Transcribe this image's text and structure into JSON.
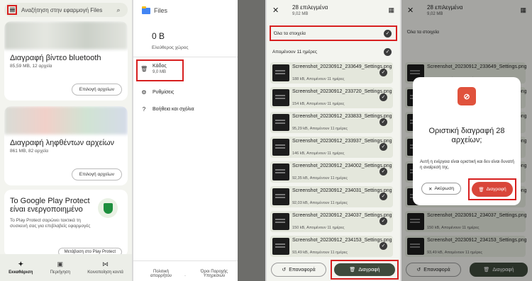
{
  "panel1": {
    "search_placeholder": "Αναζήτηση στην εφαρμογή Files",
    "card1": {
      "title": "Διαγραφή βίντεο bluetooth",
      "sub": "85,59 MB, 12 αρχεία",
      "button": "Επιλογή αρχείων"
    },
    "card2": {
      "title": "Διαγραφή ληφθέντων αρχείων",
      "sub": "861 MB, 82 αρχεία",
      "button": "Επιλογή αρχείων"
    },
    "card3": {
      "title": "To Google Play Protect είναι ενεργοποιημένο",
      "sub": "To Play Protect σαρώνει τακτικά τη συσκευή σας για επιβλαβείς εφαρμογές",
      "link": "Μετάβαση στο Play Protect"
    },
    "nav": [
      {
        "label": "Εκκαθάριση",
        "icon": "sparkle-icon"
      },
      {
        "label": "Περιήγηση",
        "icon": "browse-icon"
      },
      {
        "label": "Κοινοποίηση κοντά",
        "icon": "nearby-share-icon"
      }
    ]
  },
  "panel2": {
    "app_name": "Files",
    "storage_value": "0 B",
    "storage_label": "Ελεύθερος χώρος",
    "items": [
      {
        "label": "Κάδος",
        "sub": "9,0 MB",
        "icon": "trash-icon"
      },
      {
        "label": "Ρυθμίσεις",
        "sub": "",
        "icon": "settings-icon"
      },
      {
        "label": "Βοήθεια και σχόλια",
        "sub": "",
        "icon": "help-icon"
      }
    ],
    "footer_left": "Πολιτική απορρήτου",
    "footer_right": "Όροι Παροχής Υπηρεσιών"
  },
  "panel3": {
    "title": "28 επιλεγμένα",
    "size": "9,02 MB",
    "select_all": "Όλα τα στοιχεία",
    "group_label": "Απομένουν 11 ημέρες",
    "files": [
      {
        "name": "Screenshot_20230912_233649_Settings.png",
        "meta": "188 kB, Απομένουν 11 ημέρες"
      },
      {
        "name": "Screenshot_20230912_233720_Settings.png",
        "meta": "154 kB, Απομένουν 11 ημέρες"
      },
      {
        "name": "Screenshot_20230912_233833_Settings.png",
        "meta": "95,29 kB, Απομένουν 11 ημέρες"
      },
      {
        "name": "Screenshot_20230912_233937_Settings.png",
        "meta": "146 kB, Απομένουν 11 ημέρες"
      },
      {
        "name": "Screenshot_20230912_234002_Settings.png",
        "meta": "92,35 kB, Απομένουν 11 ημέρες"
      },
      {
        "name": "Screenshot_20230912_234031_Settings.png",
        "meta": "92,03 kB, Απομένουν 11 ημέρες"
      },
      {
        "name": "Screenshot_20230912_234037_Settings.png",
        "meta": "150 kB, Απομένουν 11 ημέρες"
      },
      {
        "name": "Screenshot_20230912_234153_Settings.png",
        "meta": "93,49 kB, Απομένουν 11 ημέρες"
      }
    ],
    "restore_label": "Επαναφορά",
    "delete_label": "Διαγραφή"
  },
  "panel4": {
    "title": "28 επιλεγμένα",
    "size": "9,02 MB",
    "select_all": "Όλα τα στοιχεία",
    "dialog_title": "Οριστική διαγραφή 28 αρχείων;",
    "dialog_body": "Αυτή η ενέργεια είναι οριστική και δεν είναι δυνατή η αναίρεσή της.",
    "cancel_label": "Ακύρωση",
    "confirm_label": "Διαγραφή",
    "restore_label": "Επαναφορά",
    "delete_label": "Διαγραφή"
  },
  "colors": {
    "highlight": "#d71f1f",
    "delete_confirm": "#d9463a",
    "dark_button": "#3f4a3c",
    "background": "#f3f4ef"
  }
}
